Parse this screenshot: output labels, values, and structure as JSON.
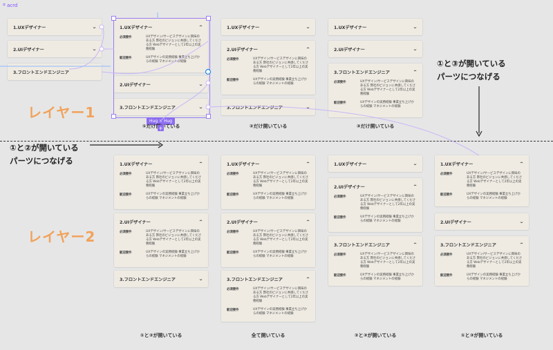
{
  "frame": {
    "name": "acrd"
  },
  "labels": {
    "layer1": "レイヤー1",
    "layer2": "レイヤー2",
    "note1_line1": "①と③が開いている",
    "note1_line2": "パーツにつなげる",
    "note2_line1": "①と②が開いている",
    "note2_line2": "パーツにつなげる",
    "hug": "Hug × Hug"
  },
  "column_labels": {
    "r1c2": "①だけ開いている",
    "r1c3": "②だけ開いている",
    "r1c4": "③だけ開いている",
    "r2c1": "①と②が開いている",
    "r2c2": "全て開いている",
    "r2c3": "②と③が開いている",
    "r2c4": "①と③が開いている"
  },
  "items": {
    "ux": "1.UXデザイナー",
    "ui": "2.UIデザイナー",
    "fe": "3.フロントエンドエンジニア"
  },
  "details": {
    "req_key": "必須要件",
    "req_val": "UXデザイン/サービスデザインに興味のある方 弊社のビジョンに共感してくださる方 Webデザイナーとして2年以上の実務経験",
    "wel_key": "歓迎要件",
    "wel_val": "UXデザインの実務経験 事業立ち上げからの経験 マネジメントの経験"
  },
  "colors": {
    "accent": "#f0a35c",
    "selection": "#9b7bf2",
    "card": "#efebe3",
    "bg": "#e6e6e6"
  }
}
